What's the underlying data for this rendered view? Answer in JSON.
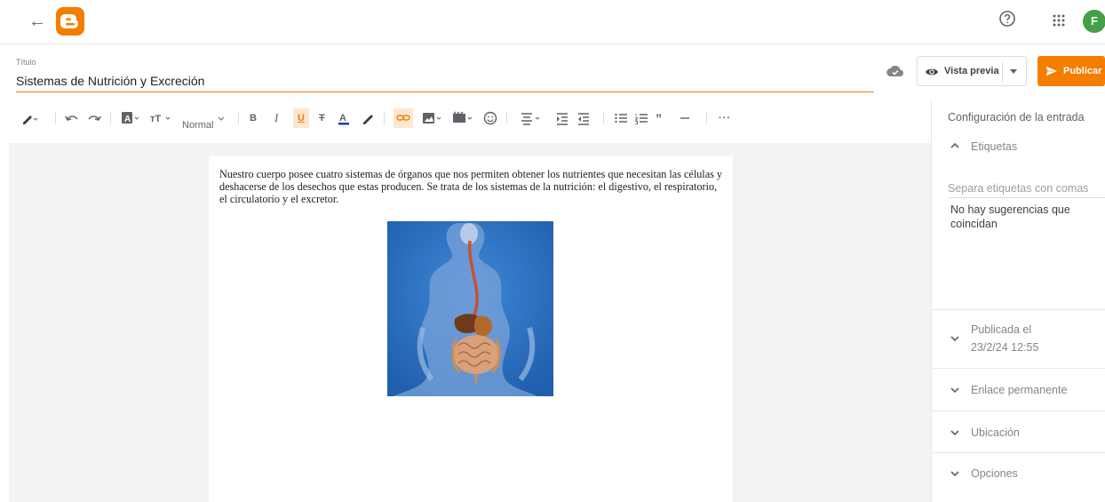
{
  "app": {
    "avatar_letter": "F",
    "brand_color": "#f57d00"
  },
  "editor": {
    "title_label": "Título",
    "title_value": "Sistemas de Nutrición y Excreción",
    "preview_label": "Vista previa",
    "publish_label": "Publicar"
  },
  "toolbar": {
    "paragraph_style": "Normal",
    "icons": [
      "pencil-icon",
      "undo-icon",
      "redo-icon",
      "text-color-icon",
      "font-size-icon",
      "bold-icon",
      "italic-icon",
      "underline-icon",
      "strikethrough-icon",
      "font-color-icon",
      "highlight-icon",
      "link-icon",
      "image-icon",
      "video-icon",
      "emoji-icon",
      "align-icon",
      "indent-icon",
      "outdent-icon",
      "bulleted-list-icon",
      "numbered-list-icon",
      "quote-icon",
      "horizontal-rule-icon",
      "more-icon"
    ]
  },
  "content": {
    "paragraph": " Nuestro cuerpo posee cuatro sistemas de órganos que nos permiten obtener los nutrientes que necesitan las células y deshacerse de los desechos que estas producen. Se trata de los sistemas de la nutrición: el digestivo, el respiratorio, el circulatorio y el excretor."
  },
  "sidebar": {
    "title": "Configuración de la entrada",
    "labels_section": "Etiquetas",
    "labels_placeholder": "Separa etiquetas con comas",
    "no_suggestions": "No hay sugerencias que coincidan",
    "published_label": "Publicada el",
    "published_date": "23/2/24 12:55",
    "permalink": "Enlace permanente",
    "location": "Ubicación",
    "options": "Opciones"
  }
}
